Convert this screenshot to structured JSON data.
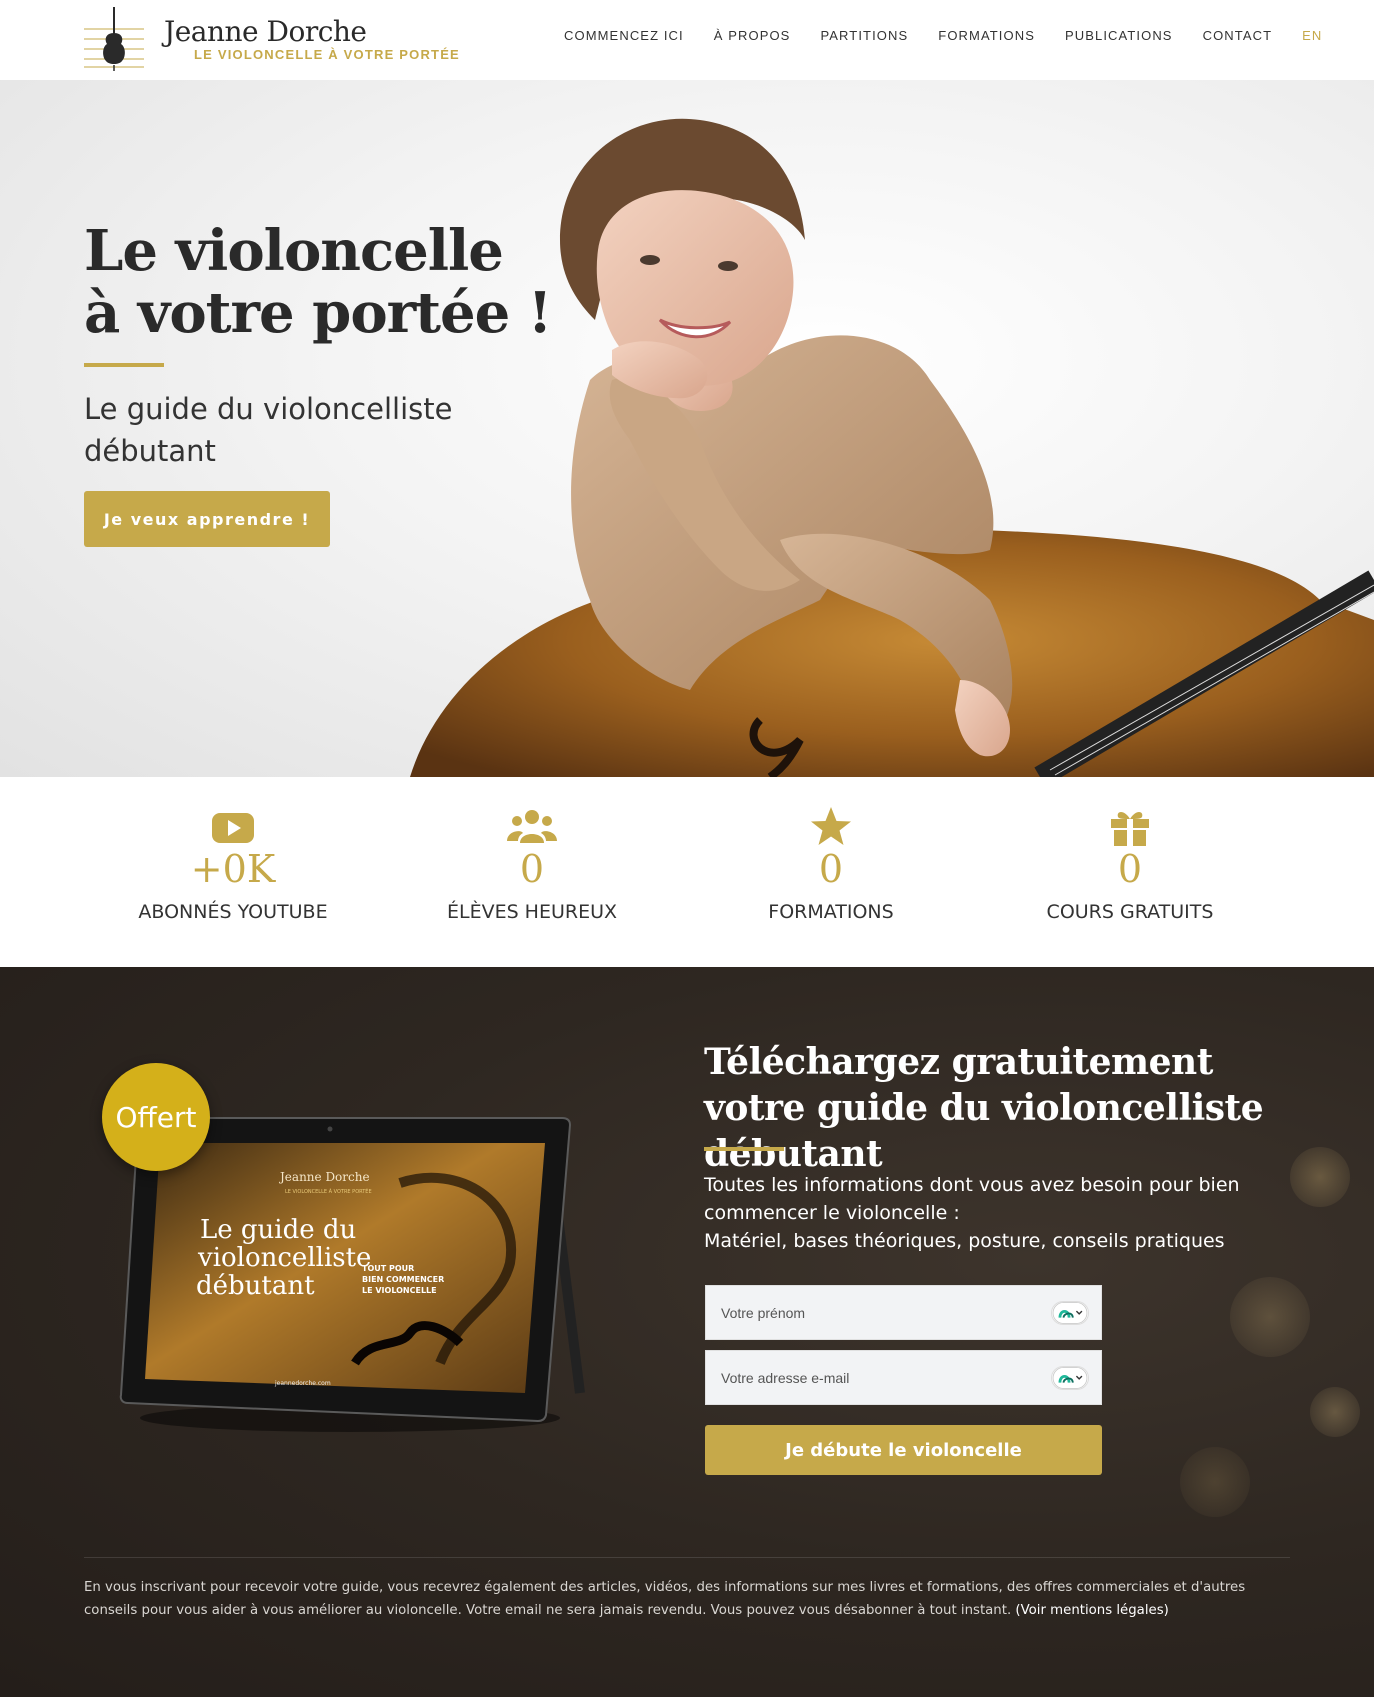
{
  "brand": {
    "name": "Jeanne Dorche",
    "tagline": "LE VIOLONCELLE À VOTRE PORTÉE"
  },
  "nav": {
    "items": [
      "COMMENCEZ ICI",
      "À PROPOS",
      "PARTITIONS",
      "FORMATIONS",
      "PUBLICATIONS",
      "CONTACT"
    ],
    "lang": "EN"
  },
  "hero": {
    "title_line1": "Le violoncelle",
    "title_line2": "à votre portée !",
    "subtitle": "Le guide du violoncelliste débutant",
    "button": "Je veux apprendre !"
  },
  "stats": [
    {
      "icon": "youtube-icon",
      "value": "+0K",
      "label": "ABONNÉS YOUTUBE"
    },
    {
      "icon": "users-icon",
      "value": "0",
      "label": "ÉLÈVES HEUREUX"
    },
    {
      "icon": "star-icon",
      "value": "0",
      "label": "FORMATIONS"
    },
    {
      "icon": "gift-icon",
      "value": "0",
      "label": "COURS GRATUITS"
    }
  ],
  "download": {
    "badge": "Offert",
    "title": "Téléchargez gratuitement votre guide du violoncelliste débutant",
    "text_line1": "Toutes les informations dont vous avez besoin pour bien commencer le violoncelle :",
    "text_line2": "Matériel, bases théoriques, posture, conseils pratiques",
    "firstname_placeholder": "Votre prénom",
    "email_placeholder": "Votre adresse e-mail",
    "submit": "Je débute le violoncelle"
  },
  "tablet_cover": {
    "brand": "Jeanne Dorche",
    "tagline": "LE VIOLONCELLE À VOTRE PORTÉE",
    "title_line1": "Le guide du",
    "title_line2": "violoncelliste",
    "title_line3": "débutant",
    "side_line1": "TOUT POUR",
    "side_line2": "BIEN COMMENCER",
    "side_line3": "LE VIOLONCELLE",
    "url": "jeannedorche.com"
  },
  "legal": {
    "text": "En vous inscrivant pour recevoir votre guide, vous recevrez également des articles, vidéos, des informations sur mes livres et formations, des offres commerciales et d'autres conseils pour vous aider à vous améliorer au violoncelle.  Votre email ne sera jamais revendu. Vous pouvez vous désabonner à tout instant. ",
    "link": "(Voir mentions légales)"
  },
  "colors": {
    "accent": "#c6a94a",
    "badge": "#d4b01a",
    "dark_bg": "#2e2721"
  }
}
